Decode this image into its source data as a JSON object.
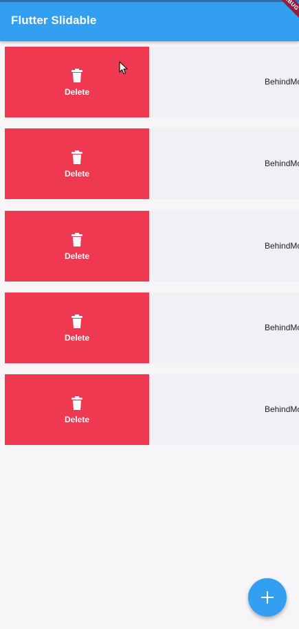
{
  "app_bar": {
    "title": "Flutter Slidable",
    "debug_banner": "DEBUG"
  },
  "list": {
    "items": [
      {
        "action_label": "Delete",
        "text": "BehindMotion",
        "action_icon": "trash-icon"
      },
      {
        "action_label": "Delete",
        "text": "BehindMotion",
        "action_icon": "trash-icon"
      },
      {
        "action_label": "Delete",
        "text": "BehindMotion",
        "action_icon": "trash-icon"
      },
      {
        "action_label": "Delete",
        "text": "BehindMotion",
        "action_icon": "trash-icon"
      },
      {
        "action_label": "Delete",
        "text": "BehindMotion",
        "action_icon": "trash-icon"
      }
    ]
  },
  "fab": {
    "icon": "plus-icon"
  },
  "colors": {
    "primary": "#329ff0",
    "delete": "#ef3950",
    "row_background": "#f2f0f5",
    "page_background": "#f7f5f8",
    "debug_banner": "#8e1f3e"
  }
}
